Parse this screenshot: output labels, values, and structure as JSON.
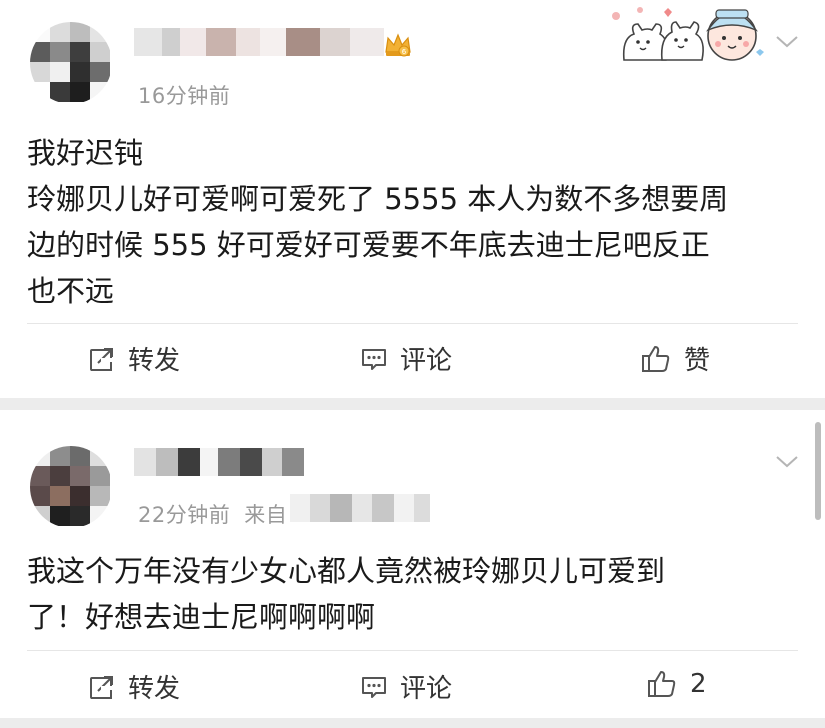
{
  "posts": [
    {
      "time": "16分钟前",
      "body_lines": [
        "我好迟钝",
        "玲娜贝儿好可爱啊可爱死了 5555 本人为数不多想要周",
        "边的时候 555 好可爱好可爱要不年底去迪士尼吧反正",
        "也不远"
      ],
      "actions": {
        "repost": "转发",
        "comment": "评论",
        "like": "赞"
      }
    },
    {
      "time": "22分钟前",
      "source_prefix": "来自",
      "body_lines": [
        "我这个万年没有少女心都人竟然被玲娜贝儿可爱到",
        "了！好想去迪士尼啊啊啊啊"
      ],
      "actions": {
        "repost": "转发",
        "comment": "评论",
        "like": "2"
      }
    }
  ],
  "icons": {
    "repost": "repost-icon",
    "comment": "comment-icon",
    "like": "thumbs-up-icon",
    "chevron": "chevron-down-icon",
    "badge": "crown-badge-icon"
  },
  "colors": {
    "text": "#1a1a1a",
    "meta": "#999999",
    "separator": "#ececec",
    "badge": "#e8a020"
  }
}
